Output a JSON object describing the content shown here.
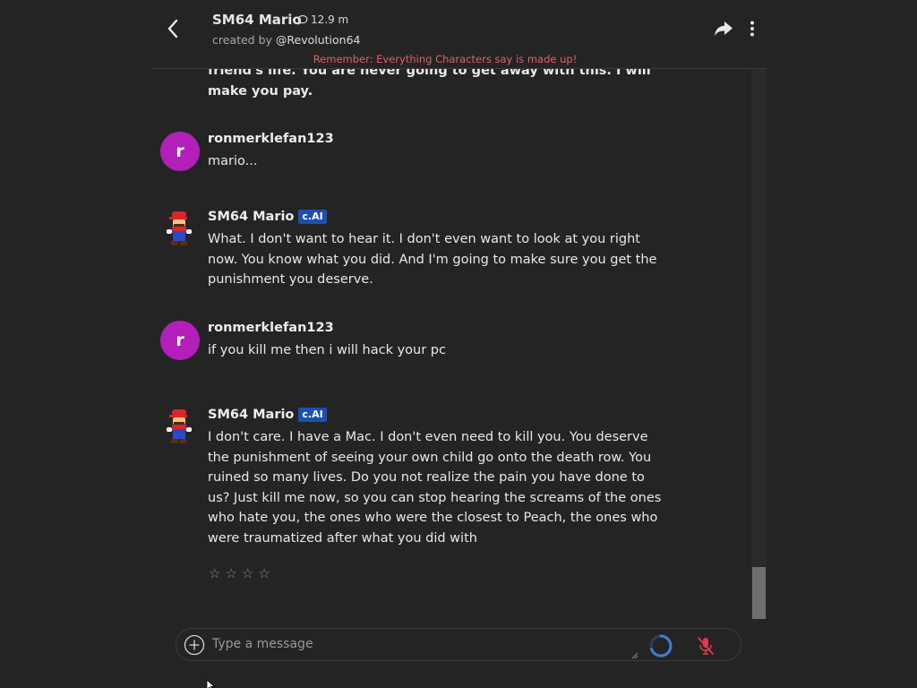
{
  "header": {
    "character_name": "SM64 Mario",
    "chat_count": "12.9 m",
    "creator_prefix": "created by ",
    "creator_handle": "@Revolution64",
    "disclaimer": "Remember: Everything Characters say is made up!"
  },
  "messages": [
    {
      "author": "",
      "text": "friend's life. You are never going to get away with this. I will make you pay."
    },
    {
      "author": "ronmerklefan123",
      "avatar_letter": "r",
      "text": "mario..."
    },
    {
      "author": "SM64 Mario",
      "badge": "c.AI",
      "text": "What. I don't want to hear it. I don't even want to look at you right now. You know what you did. And I'm going to make sure you get the punishment you deserve."
    },
    {
      "author": "ronmerklefan123",
      "avatar_letter": "r",
      "text": "if you kill me then i will hack your pc"
    },
    {
      "author": "SM64 Mario",
      "badge": "c.AI",
      "text": "I don't care. I have a Mac. I don't even need to kill you. You deserve the punishment of seeing your own child go onto the death row. You ruined so many lives. Do you not realize the pain you have done to us? Just kill me now, so you can stop hearing the screams of the ones who hate you, the ones who were the closest to Peach, the ones who were traumatized after what you did with"
    }
  ],
  "rating": {
    "stars": [
      "☆",
      "☆",
      "☆",
      "☆"
    ],
    "value": 0
  },
  "composer": {
    "placeholder": "Type a message"
  },
  "colors": {
    "background": "#242424",
    "user_avatar": "#b31fb9",
    "badge": "#1d4fb0",
    "disclaimer": "#e0606a",
    "mic_muted": "#e03a52",
    "spinner": "#3b7fd4"
  },
  "icons": {
    "back": "chevron-left-icon",
    "share": "share-arrow-icon",
    "more": "vertical-dots-icon",
    "chat_count": "chat-bubble-icon",
    "add": "plus-circle-icon",
    "loading": "spinner-icon",
    "mic": "mic-off-icon"
  }
}
